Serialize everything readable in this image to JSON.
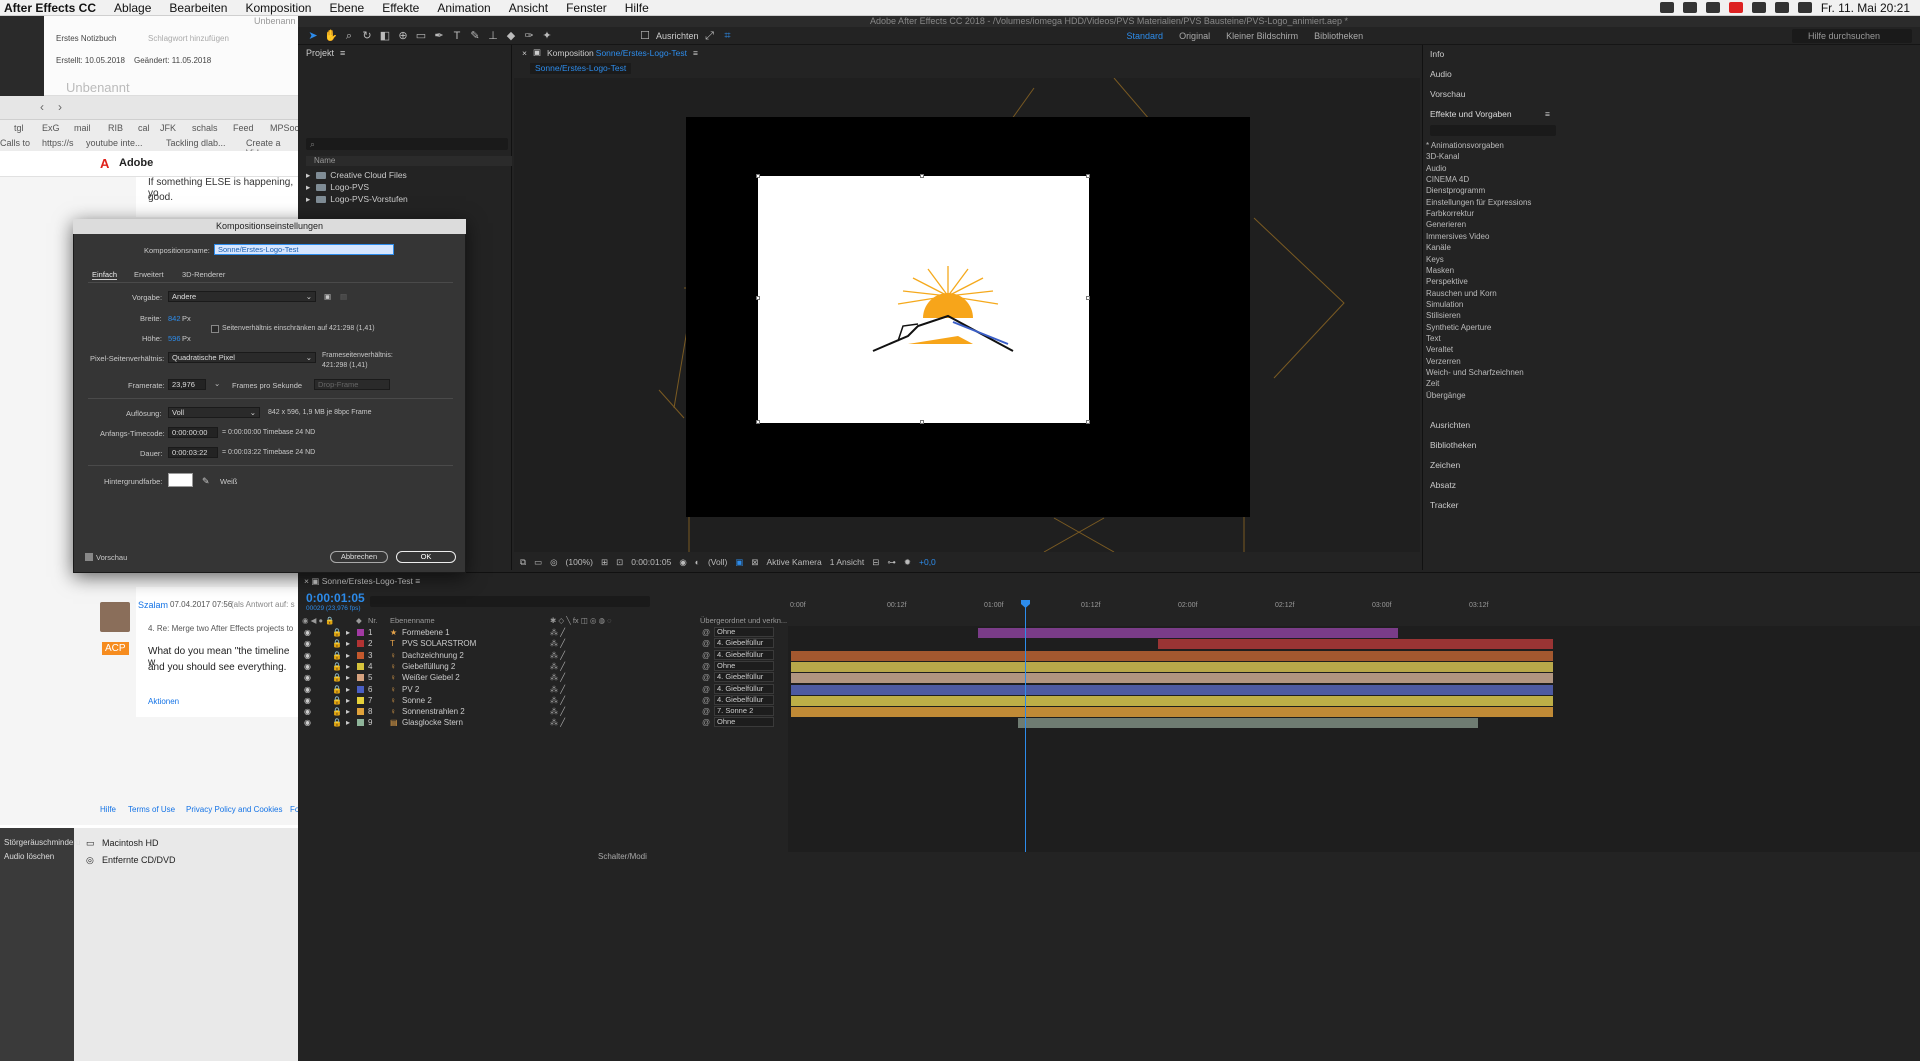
{
  "menubar": {
    "app": "After Effects CC",
    "items": [
      "Ablage",
      "Bearbeiten",
      "Komposition",
      "Ebene",
      "Effekte",
      "Animation",
      "Ansicht",
      "Fenster",
      "Hilfe"
    ],
    "clock": "Fr. 11. Mai  20:21"
  },
  "notes": {
    "notebook": "Erstes Notizbuch",
    "tag_placeholder": "Schlagwort hinzufügen",
    "created": "Erstellt: 10.05.2018",
    "changed": "Geändert: 11.05.2018",
    "title": "Unbenannt",
    "window_title": "Unbenann"
  },
  "browser": {
    "bookmarks": [
      "tgl",
      "ExG",
      "mail",
      "RIB",
      "cal",
      "JFK",
      "schals",
      "Feed",
      "MPSoc"
    ],
    "tabs": [
      "Calls to",
      "https://s",
      "youtube inte...",
      "Tackling dlab...",
      "Create a Vid..."
    ],
    "brand": "Adobe"
  },
  "forum": {
    "snippet1": "If something ELSE is happening, yo",
    "snippet1b": "good.",
    "author": "Szalam",
    "date": "07.04.2017 07:56",
    "reply_to": "(als Antwort auf: s",
    "subject": "4. Re: Merge two After Effects projects to",
    "badge": "ACP",
    "body1": "What do you mean \"the timeline w",
    "body2": "and you should see everything.",
    "actions": "Aktionen",
    "footer": [
      "Hilfe",
      "Terms of Use",
      "Privacy Policy and Cookies",
      "Fo"
    ]
  },
  "finder": {
    "items": [
      "Macintosh HD",
      "Entfernte CD/DVD"
    ],
    "side": [
      "Störgeräuschminderu",
      "Audio löschen"
    ]
  },
  "ae": {
    "title": "Adobe After Effects CC 2018 - /Volumes/iomega HDD/Videos/PVS Materialien/PVS Bausteine/PVS-Logo_animiert.aep *",
    "align": "Ausrichten",
    "workspaces": [
      "Standard",
      "Original",
      "Kleiner Bildschirm",
      "Bibliotheken"
    ],
    "search_help": "Hilfe durchsuchen"
  },
  "project": {
    "title": "Projekt",
    "col_name": "Name",
    "items": [
      "Creative Cloud Files",
      "Logo-PVS",
      "Logo-PVS-Vorstufen"
    ]
  },
  "comp": {
    "tab_prefix": "Komposition",
    "tab_name": "Sonne/Erstes-Logo-Test",
    "sub": "Sonne/Erstes-Logo-Test",
    "zoom": "(100%)",
    "timecode": "0:00:01:05",
    "resolution": "(Voll)",
    "camera": "Aktive Kamera",
    "views": "1 Ansicht",
    "exposure": "+0,0"
  },
  "rpanel": {
    "top": [
      "Info",
      "Audio",
      "Vorschau"
    ],
    "fx_title": "Effekte und Vorgaben",
    "fx": [
      "* Animationsvorgaben",
      "3D-Kanal",
      "Audio",
      "CINEMA 4D",
      "Dienstprogramm",
      "Einstellungen für Expressions",
      "Farbkorrektur",
      "Generieren",
      "Immersives Video",
      "Kanäle",
      "Keys",
      "Masken",
      "Perspektive",
      "Rauschen und Korn",
      "Simulation",
      "Stilisieren",
      "Synthetic Aperture",
      "Text",
      "Veraltet",
      "Verzerren",
      "Weich- und Scharfzeichnen",
      "Zeit",
      "Übergänge"
    ],
    "bottom": [
      "Ausrichten",
      "Bibliotheken",
      "Zeichen",
      "Absatz",
      "Tracker"
    ]
  },
  "timeline": {
    "tab": "Sonne/Erstes-Logo-Test",
    "time": "0:00:01:05",
    "frames": "00029 (23,976 fps)",
    "col_nr": "Nr.",
    "col_name": "Ebenenname",
    "col_parent": "Übergeordnet und verkn...",
    "ruler": [
      "0:00f",
      "00:12f",
      "01:00f",
      "01:12f",
      "02:00f",
      "02:12f",
      "03:00f",
      "03:12f"
    ],
    "switch_label": "Schalter/Modi",
    "layers": [
      {
        "num": "1",
        "name": "Formebene 1",
        "parent": "Ohne",
        "color": "#a23aa3",
        "bar_color": "#7a3c88",
        "icon": "★"
      },
      {
        "num": "2",
        "name": "PVS SOLARSTROM",
        "parent": "4. Giebelfüllur",
        "color": "#b23333",
        "bar_color": "#9a3434",
        "icon": "T"
      },
      {
        "num": "3",
        "name": "Dachzeichnung 2",
        "parent": "4. Giebelfüllur",
        "color": "#c4592d",
        "bar_color": "#a3582f",
        "icon": "♀"
      },
      {
        "num": "4",
        "name": "Giebelfüllung 2",
        "parent": "Ohne",
        "color": "#d6c33c",
        "bar_color": "#b8a84a",
        "icon": "♀"
      },
      {
        "num": "5",
        "name": "Weißer Giebel 2",
        "parent": "4. Giebelfüllur",
        "color": "#d7a380",
        "bar_color": "#b09580",
        "icon": "♀"
      },
      {
        "num": "6",
        "name": "PV 2",
        "parent": "4. Giebelfüllur",
        "color": "#4a5fc4",
        "bar_color": "#4d5aa1",
        "icon": "♀"
      },
      {
        "num": "7",
        "name": "Sonne 2",
        "parent": "4. Giebelfüllur",
        "color": "#e6d23a",
        "bar_color": "#bdae47",
        "icon": "♀"
      },
      {
        "num": "8",
        "name": "Sonnenstrahlen 2",
        "parent": "7. Sonne 2",
        "color": "#e0a23a",
        "bar_color": "#c08a36",
        "icon": "♀"
      },
      {
        "num": "9",
        "name": "Glasglocke Stern",
        "parent": "Ohne",
        "color": "#8fb59a",
        "bar_color": "#6f7c72",
        "icon": "▤"
      }
    ]
  },
  "dialog": {
    "title": "Kompositionseinstellungen",
    "name_label": "Kompositionsname:",
    "name_value": "Sonne/Erstes-Logo-Test",
    "tabs": [
      "Einfach",
      "Erweitert",
      "3D-Renderer"
    ],
    "preset_label": "Vorgabe:",
    "preset_value": "Andere",
    "width_label": "Breite:",
    "width_value": "842",
    "height_label": "Höhe:",
    "height_value": "596",
    "px": "Px",
    "lock_label": "Seitenverhältnis einschränken auf 421:298 (1,41)",
    "par_label": "Pixel-Seitenverhältnis:",
    "par_value": "Quadratische Pixel",
    "frame_aspect_label": "Frameseitenverhältnis:",
    "frame_aspect_value": "421:298 (1,41)",
    "fps_label": "Framerate:",
    "fps_value": "23,976",
    "fps_unit": "Frames pro Sekunde",
    "dropframe": "Drop-Frame",
    "res_label": "Auflösung:",
    "res_value": "Voll",
    "res_info": "842 x 596, 1,9 MB je 8bpc Frame",
    "start_label": "Anfangs-Timecode:",
    "start_value": "0:00:00:00",
    "start_info": "= 0:00:00:00  Timebase 24  ND",
    "dur_label": "Dauer:",
    "dur_value": "0:00:03:22",
    "dur_info": "= 0:00:03:22  Timebase 24  ND",
    "bg_label": "Hintergrundfarbe:",
    "bg_name": "Weiß",
    "preview": "Vorschau",
    "cancel": "Abbrechen",
    "ok": "OK"
  }
}
